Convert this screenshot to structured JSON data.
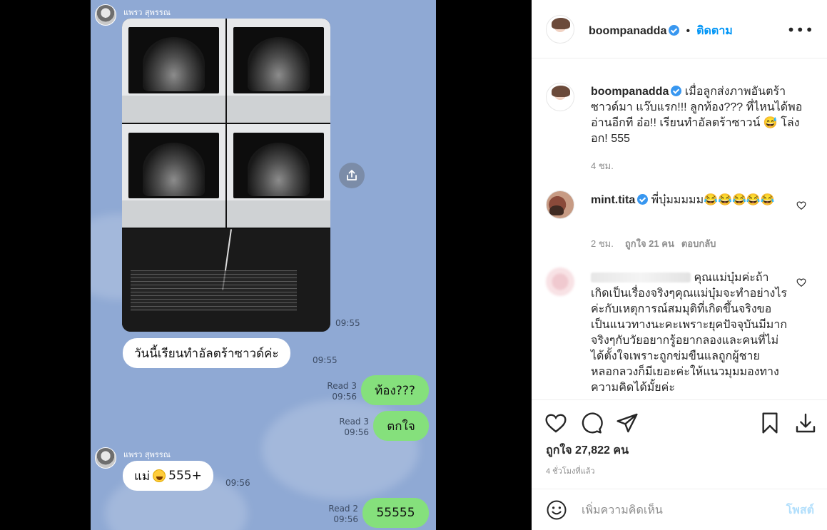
{
  "chat": {
    "sender_1": "แพรว สุพรรณ",
    "photo_time": "09:55",
    "msg_1": "วันนี้เรียนทำอัลตร้าซาวด์ค่ะ",
    "msg_1_time": "09:55",
    "reply_1": {
      "read": "Read 3",
      "time": "09:56",
      "text": "ท้อง???"
    },
    "reply_2": {
      "read": "Read 3",
      "time": "09:56",
      "text": "ตกใจ"
    },
    "sender_2": "แพรว สุพรรณ",
    "msg_2_prefix": "แม่",
    "msg_2_suffix": " 555+",
    "msg_2_time": "09:56",
    "reply_3": {
      "read": "Read 2",
      "time": "09:56",
      "text": "55555"
    }
  },
  "post": {
    "username": "boompanadda",
    "follow_label": "ติดตาม",
    "dot": "•",
    "more_icon": "more-options-icon",
    "caption_user": "boompanadda",
    "caption_text": "เมื่อลูกส่งภาพอันตร้าซาวด์มา แว๊บแรก!!! ลูกท้อง??? ที่ไหนได้พออ่านอีกที อ๋อ!! เรียนทำอัลตร้าซาวน์ 😅 โล่งอก! 555",
    "caption_time": "4 ชม."
  },
  "comments": [
    {
      "user": "mint.tita",
      "text": "พี่บุ๋มมมมม😂😂😂😂😂",
      "time": "2 ชม.",
      "likes": "ถูกใจ 21 คน",
      "reply": "ตอบกลับ"
    },
    {
      "user": "",
      "text": "คุณแม่บุ๋มค่ะถ้าเกิดเป็นเรื่องจริงๆคุณแม่บุ๋มจะทำอย่างไรค่ะกับเหตุการณ์สมมุติที่เกิดขึ้นจริงขอเป็นแนวทางนะคะเพราะยุคปัจจุบันมีมากจริงๆกับวัยอยากรู้อยากลองและคนที่ไม่ได้ตั้งใจเพราะถูกข่มขืนแลถูกผู้ชายหลอกลวงก็มีเยอะค่ะให้แนวมุมมองทางความคิดได้มั้ยค่ะ"
    }
  ],
  "actions": {
    "likes_label": "ถูกใจ 27,822 คน",
    "ago": "4 ชั่วโมงที่แล้ว",
    "comment_placeholder": "เพิ่มความคิดเห็น",
    "post_label": "โพสต์"
  },
  "colors": {
    "chat_bg": "#8fa9d4",
    "bubble_out": "#85e07c",
    "link_blue": "#0095f6",
    "verified_blue": "#3897f0"
  }
}
